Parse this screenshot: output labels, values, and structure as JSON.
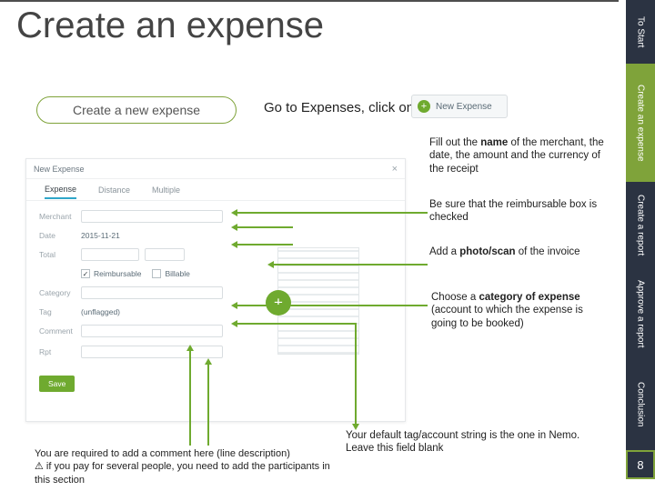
{
  "title": "Create an expense",
  "nav": {
    "to_start": "To Start",
    "create_expense": "Create an expense",
    "create_report": "Create a report",
    "approve": "Approve a report",
    "conclusion": "Conclusion",
    "page": "8"
  },
  "pill": "Create a new expense",
  "instruction": "Go to Expenses, click on",
  "new_expense_btn": "New Expense",
  "mock": {
    "header": "New Expense",
    "tabs": {
      "expense": "Expense",
      "distance": "Distance",
      "multiple": "Multiple"
    },
    "labels": {
      "merchant": "Merchant",
      "date": "Date",
      "total": "Total",
      "reimbursable": "Reimbursable",
      "billable": "Billable",
      "category": "Category",
      "tag": "Tag",
      "comment": "Comment",
      "rpt": "Rpt"
    },
    "values": {
      "date": "2015-11-21",
      "tag": "(unflagged)"
    },
    "save": "Save"
  },
  "ann": {
    "a1_pre": "Fill out the ",
    "a1_b": "name",
    "a1_post": " of the merchant, the date, the amount and the currency of the receipt",
    "a2": "Be sure that the reimbursable box is checked",
    "a3_pre": "Add a ",
    "a3_b": "photo/scan",
    "a3_post": " of the invoice",
    "a4_pre": "Choose a ",
    "a4_b": "category of expense",
    "a4_post": " (account to which the expense is going to be booked)"
  },
  "bot": {
    "b1": "Your default tag/account string is the one in Nemo. Leave this field blank",
    "b2_line1": "You are required to add a comment here (line description)",
    "b2_warn": "⚠",
    "b2_line2": " if you pay for several people, you need to add the participants in this section"
  }
}
